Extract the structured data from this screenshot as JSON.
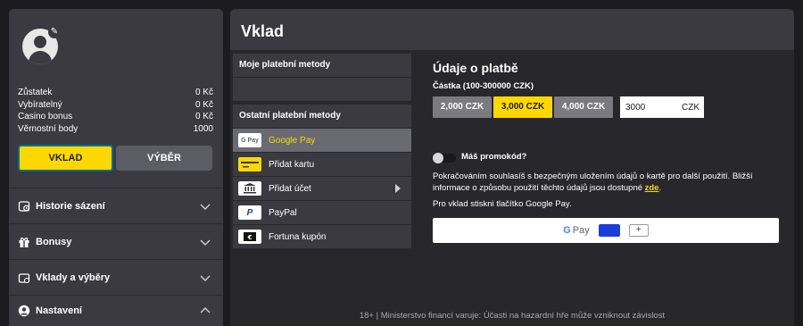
{
  "sidebar": {
    "stats": [
      {
        "label": "Zůstatek",
        "value": "0 Kč"
      },
      {
        "label": "Vybíratelný",
        "value": "0 Kč"
      },
      {
        "label": "Casino bonus",
        "value": "0 Kč"
      },
      {
        "label": "Věrnostní body",
        "value": "1000"
      }
    ],
    "deposit_button": "VKLAD",
    "withdraw_button": "VÝBĚR",
    "menu": [
      {
        "label": "Historie sázení",
        "icon": "history-icon"
      },
      {
        "label": "Bonusy",
        "icon": "gift-icon"
      },
      {
        "label": "Vklady a výběry",
        "icon": "wallet-icon"
      },
      {
        "label": "Nastavení",
        "icon": "user-icon"
      }
    ]
  },
  "main": {
    "title": "Vklad",
    "my_methods_header": "Moje platební metody",
    "other_methods_header": "Ostatní platební metody",
    "methods": [
      {
        "label": "Google Pay",
        "icon": "google-pay-icon",
        "active": true
      },
      {
        "label": "Přidat kartu",
        "icon": "card-icon"
      },
      {
        "label": "Přidat účet",
        "icon": "bank-icon"
      },
      {
        "label": "PayPal",
        "icon": "paypal-icon"
      },
      {
        "label": "Fortuna kupón",
        "icon": "coupon-icon"
      }
    ],
    "payment": {
      "title": "Údaje o platbě",
      "amount_label": "Částka (100-300000 CZK)",
      "presets": [
        "2,000 CZK",
        "3,000 CZK",
        "4,000 CZK"
      ],
      "selected_preset": "3,000 CZK",
      "amount_value": "3000",
      "currency": "CZK",
      "promo_label": "Máš promokód?",
      "info_text": "Pokračováním souhlasíš s bezpečným uložením údajů o kartě pro další použití. Bližší informace o způsobu použití těchto údajů jsou dostupné ",
      "info_link": "zde",
      "info_end": ".",
      "gpay_note": "Pro vklad stiskni tlačítko Google Pay.",
      "gpay_label": "Pay",
      "gpay_g": "G",
      "gpay_plus": "+"
    },
    "footer": "18+ | Ministerstvo financí varuje: Účasti na hazardní hře může vzniknout závislost"
  },
  "colors": {
    "accent": "#fdd800",
    "panel": "#3a3a40",
    "background": "#1c1c1f"
  }
}
